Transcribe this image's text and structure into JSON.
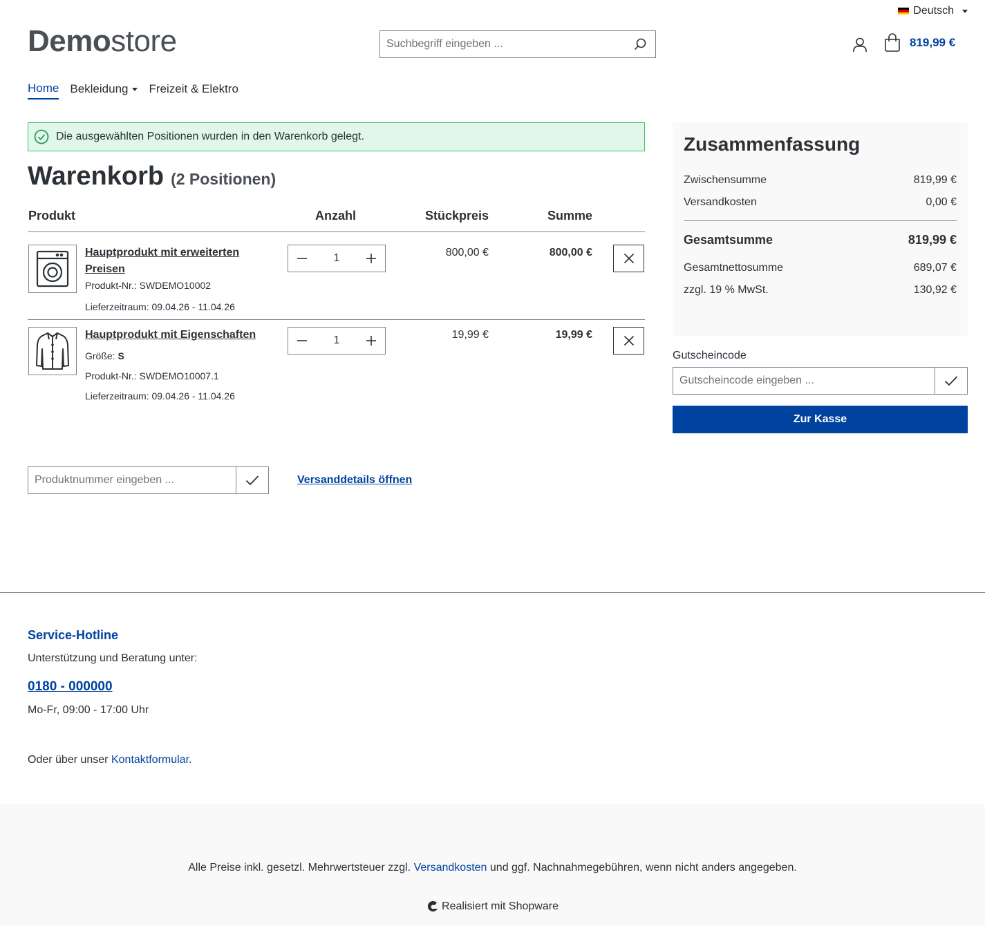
{
  "header": {
    "language": "Deutsch",
    "logo_bold": "Demo",
    "logo_light": "store",
    "search_placeholder": "Suchbegriff eingeben ...",
    "cart_total": "819,99 €"
  },
  "nav": {
    "items": [
      {
        "label": "Home",
        "active": true
      },
      {
        "label": "Bekleidung",
        "has_dropdown": true
      },
      {
        "label": "Freizeit & Elektro"
      }
    ]
  },
  "alert": {
    "message": "Die ausgewählten Positionen wurden in den Warenkorb gelegt."
  },
  "cart": {
    "title": "Warenkorb",
    "count": "(2 Positionen)",
    "columns": {
      "product": "Produkt",
      "quantity": "Anzahl",
      "unit_price": "Stückpreis",
      "total": "Summe"
    },
    "items": [
      {
        "name": "Hauptprodukt mit erweiterten Preisen",
        "icon": "washing-machine-icon",
        "product_no_label": "Produkt-Nr.:",
        "product_no": "SWDEMO10002",
        "delivery_label": "Lieferzeitraum:",
        "delivery": "09.04.26 - 11.04.26",
        "quantity": "1",
        "unit_price": "800,00 €",
        "total": "800,00 €"
      },
      {
        "name": "Hauptprodukt mit Eigenschaften",
        "icon": "jacket-icon",
        "size_label": "Größe:",
        "size": "S",
        "product_no_label": "Produkt-Nr.:",
        "product_no": "SWDEMO10007.1",
        "delivery_label": "Lieferzeitraum:",
        "delivery": "09.04.26 - 11.04.26",
        "quantity": "1",
        "unit_price": "19,99 €",
        "total": "19,99 €"
      }
    ],
    "add_product_placeholder": "Produktnummer eingeben ...",
    "shipping_link": "Versanddetails öffnen"
  },
  "summary": {
    "title": "Zusammenfassung",
    "subtotal_label": "Zwischensumme",
    "subtotal": "819,99 €",
    "shipping_label": "Versandkosten",
    "shipping": "0,00 €",
    "grand_total_label": "Gesamtsumme",
    "grand_total": "819,99 €",
    "net_total_label": "Gesamtnettosumme",
    "net_total": "689,07 €",
    "tax_label": "zzgl. 19 % MwSt.",
    "tax": "130,92 €",
    "voucher_label": "Gutscheincode",
    "voucher_placeholder": "Gutscheincode eingeben ...",
    "checkout_label": "Zur Kasse"
  },
  "footer": {
    "hotline_title": "Service-Hotline",
    "hotline_sub": "Unterstützung und Beratung unter:",
    "phone": "0180 - 000000",
    "hours": "Mo-Fr, 09:00 - 17:00 Uhr",
    "contact_prefix": "Oder über unser",
    "contact_link": "Kontaktformular",
    "contact_suffix": ".",
    "vat_prefix": "Alle Preise inkl. gesetzl. Mehrwertsteuer zzgl.",
    "vat_link": "Versandkosten",
    "vat_suffix": "und ggf. Nachnahmegebühren, wenn nicht anders angegeben.",
    "powered": "Realisiert mit Shopware"
  },
  "colors": {
    "primary": "#0042a0",
    "alert_bg": "#e1f7ec",
    "alert_border": "#3cc261",
    "text": "#2b3136",
    "summary_bg": "#f9f9f9"
  }
}
